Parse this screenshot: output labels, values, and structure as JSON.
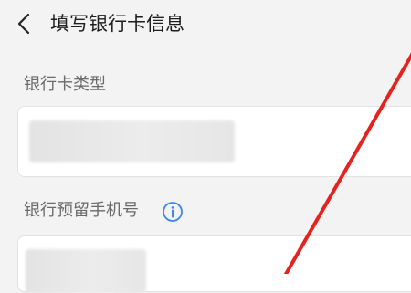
{
  "header": {
    "title": "填写银行卡信息",
    "back_icon": "chevron-left-icon"
  },
  "form": {
    "card_type_label": "银行卡类型",
    "phone_label": "银行预留手机号",
    "info_icon": "info-icon"
  },
  "colors": {
    "background": "#f3f3f3",
    "card": "#ffffff",
    "accent": "#3f86e8",
    "annotation_red": "#e4231f"
  }
}
